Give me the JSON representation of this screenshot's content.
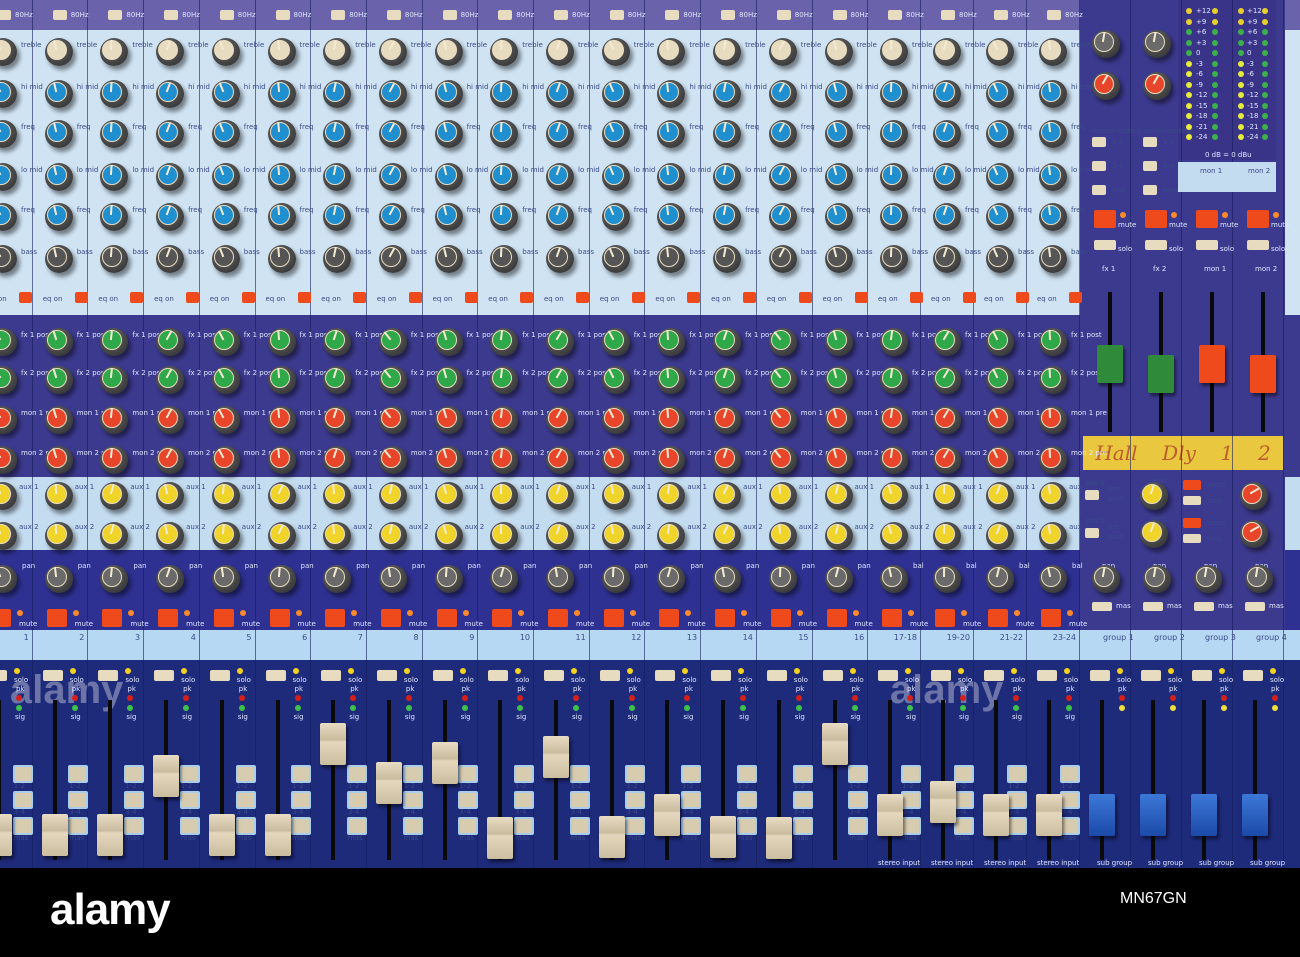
{
  "mono_channels": [
    "1",
    "2",
    "3",
    "4",
    "5",
    "6",
    "7",
    "8",
    "9",
    "10",
    "11",
    "12",
    "13",
    "14",
    "15",
    "16"
  ],
  "stereo_channels": [
    "17-18",
    "19-20",
    "21-22",
    "23-24"
  ],
  "groups": [
    "group 1",
    "group 2",
    "group 3",
    "group 4"
  ],
  "returns": [
    "fx 1",
    "fx 2",
    "mon 1",
    "mon 2"
  ],
  "meter_channels": [
    "mon 1",
    "mon 2"
  ],
  "labels": {
    "hpf": "80Hz",
    "treble": "treble",
    "hi_mid": "hi mid",
    "freq": "freq",
    "lo_mid": "lo mid",
    "bass": "bass",
    "eq_on": "eq on",
    "fx1": "fx 1 post",
    "fx2": "fx 2 post",
    "mon1": "mon 1 pre",
    "mon2": "mon 2 pre",
    "aux1": "aux 1",
    "aux2": "aux 2",
    "pan": "pan",
    "bal": "bal",
    "mute": "mute",
    "solo": "solo",
    "pk": "pk",
    "sig": "sig",
    "r12": "1-2",
    "r34": "3-4",
    "mas": "mas",
    "return_routing": "return-routing",
    "send": "send",
    "pre": "pre",
    "post": "post",
    "sub_group": "sub group",
    "stereo_input": "stereo input"
  },
  "meter": {
    "scale": [
      "+12",
      "+9",
      "+6",
      "+3",
      "0",
      "-3",
      "-6",
      "-9",
      "-12",
      "-15",
      "-18",
      "-21",
      "-24"
    ],
    "ref": "0 dB = 0 dBu"
  },
  "tape_label": [
    "Hall",
    "Dly",
    "1",
    "2"
  ],
  "fader_levels": [
    0.05,
    0.05,
    0.05,
    0.5,
    0.05,
    0.05,
    0.75,
    0.45,
    0.6,
    0.02,
    0.65,
    0.03,
    0.2,
    0.03,
    0.02,
    0.75,
    0.2,
    0.3,
    0.2,
    0.2,
    0.2,
    0.2,
    0.2,
    0.2,
    0.05,
    0.05,
    0.05,
    0.05
  ],
  "colors": {
    "eq_panel": "#cfe3f3",
    "dark_panel": "#3c3a8e",
    "fader_panel": "#1e2a7a",
    "mute": "#ee4a1c",
    "knob_blue": "#1f8fd0",
    "knob_green": "#2fa84a",
    "knob_red": "#e8452a",
    "knob_yellow": "#f0d42a",
    "knob_cream": "#e8dcc0",
    "knob_grey": "#6a6a6a"
  },
  "watermark": "alamy",
  "footer": {
    "logo": "alamy",
    "image_id": "MN67GN"
  }
}
